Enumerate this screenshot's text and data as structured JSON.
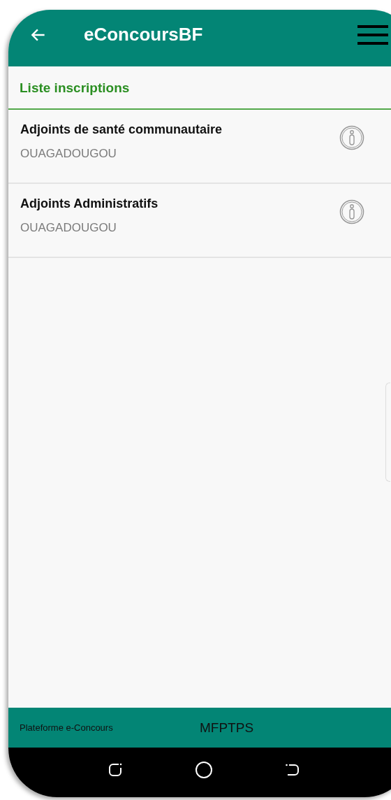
{
  "app_bar": {
    "title": "eConcoursBF"
  },
  "section": {
    "title": "Liste inscriptions"
  },
  "items": [
    {
      "title": "Adjoints de santé communautaire",
      "subtitle": "OUAGADOUGOU"
    },
    {
      "title": "Adjoints Administratifs",
      "subtitle": "OUAGADOUGOU"
    }
  ],
  "footer": {
    "left": "Plateforme e-Concours",
    "center": "MFPTPS"
  }
}
